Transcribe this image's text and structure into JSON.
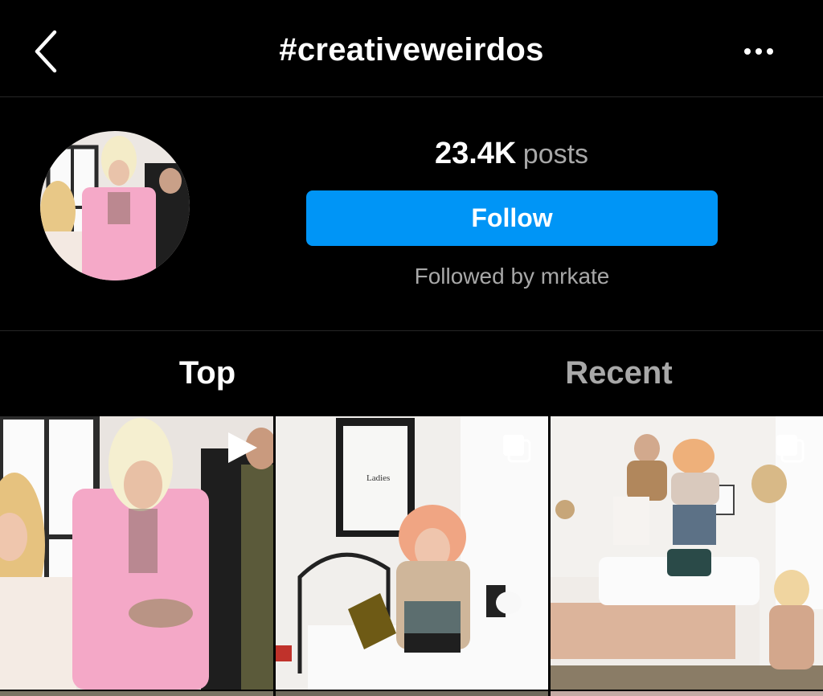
{
  "header": {
    "title": "#creativeweirdos"
  },
  "hashtag": {
    "posts_count": "23.4K",
    "posts_label": "posts",
    "follow_label": "Follow",
    "followed_by": "Followed by mrkate"
  },
  "tabs": [
    {
      "label": "Top",
      "active": true
    },
    {
      "label": "Recent",
      "active": false
    }
  ],
  "posts": [
    {
      "type": "video",
      "icon": "play-icon"
    },
    {
      "type": "carousel",
      "icon": "multiple-photos-icon"
    },
    {
      "type": "carousel",
      "icon": "multiple-photos-icon"
    }
  ],
  "colors": {
    "background": "#000000",
    "follow_button": "#0095f6",
    "secondary_text": "#a8a8a8"
  }
}
